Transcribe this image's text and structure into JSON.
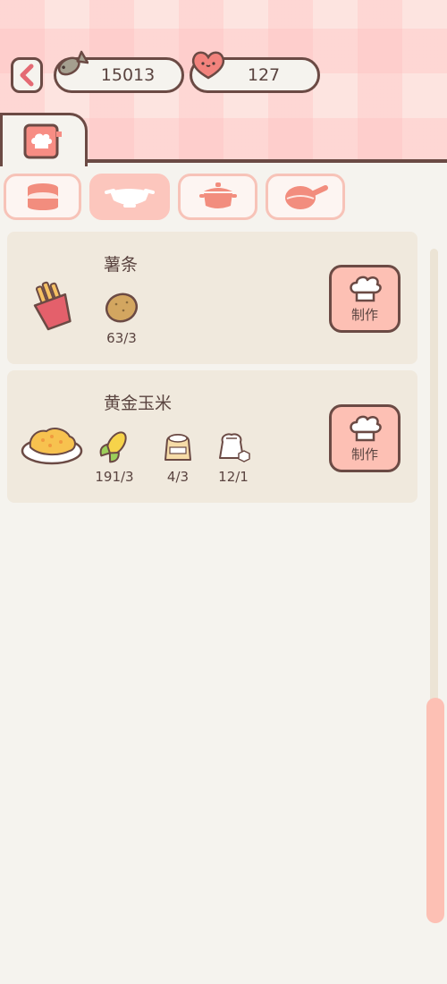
{
  "currency": {
    "fish": "15013",
    "heart": "127"
  },
  "categories": [
    {
      "name": "steamer",
      "active": false
    },
    {
      "name": "bowl",
      "active": true
    },
    {
      "name": "pot",
      "active": false
    },
    {
      "name": "pan",
      "active": false
    }
  ],
  "recipes": [
    {
      "name": "薯条",
      "icon": "fries-icon",
      "ingredients": [
        {
          "icon": "potato-icon",
          "qty": "63/3"
        }
      ],
      "button_label": "制作"
    },
    {
      "name": "黄金玉米",
      "icon": "golden-corn-dish-icon",
      "ingredients": [
        {
          "icon": "corn-icon",
          "qty": "191/3"
        },
        {
          "icon": "flour-sack-icon",
          "qty": "4/3"
        },
        {
          "icon": "salt-sack-icon",
          "qty": "12/1"
        }
      ],
      "button_label": "制作"
    }
  ],
  "colors": {
    "outline": "#6b4a44",
    "accent": "#fdc0b4",
    "card": "#f0e9dd",
    "background": "#f5f3ee"
  }
}
